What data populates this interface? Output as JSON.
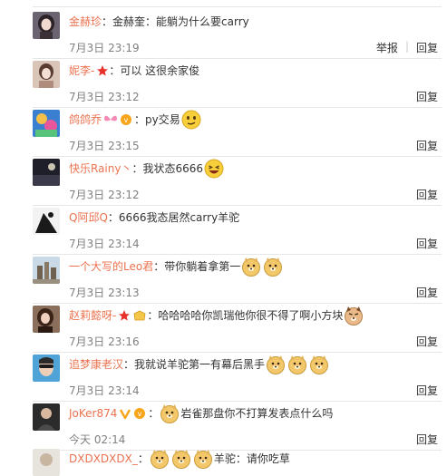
{
  "comments": [
    {
      "username": "金赫珍",
      "text": "金赫奎：能躺为什么要carry",
      "time": "7月3日 23:19",
      "actions": [
        "举报",
        "回复"
      ]
    },
    {
      "username": "妮李-",
      "text": "可以 这很余家俊",
      "time": "7月3日 23:12",
      "actions": [
        "回复"
      ]
    },
    {
      "username": "鸽鸽乔",
      "text": "py交易",
      "time": "7月3日 23:15",
      "actions": [
        "回复"
      ]
    },
    {
      "username": "快乐Rainy丶",
      "text": "我状态6666",
      "time": "7月3日 23:12",
      "actions": [
        "回复"
      ]
    },
    {
      "username": "Q阿邱Q",
      "text": "6666我态居然carry羊驼",
      "time": "7月3日 23:14",
      "actions": [
        "回复"
      ]
    },
    {
      "username": "一个大写的Leo君",
      "text": "带你躺着拿第一",
      "time": "7月3日 23:13",
      "actions": [
        "回复"
      ]
    },
    {
      "username": "赵莉懿呀-",
      "text": "哈哈哈哈你凯瑞他你很不得了啊小方块",
      "time": "7月3日 23:16",
      "actions": [
        "回复"
      ]
    },
    {
      "username": "追梦康老汉",
      "text": "我就说羊驼第一有幕后黑手",
      "time": "7月3日 23:14",
      "actions": [
        "回复"
      ]
    },
    {
      "username": "JoKer874",
      "text": "岩雀那盘你不打算发表点什么吗",
      "time": "今天 02:14",
      "actions": [
        "回复"
      ]
    },
    {
      "username": "DXDXDXDX_",
      "text": "羊驼：请你吃草",
      "time": "",
      "actions": []
    }
  ],
  "colors": {
    "username": "#eb7350",
    "text": "#333333",
    "time": "#808080",
    "divider": "#e6e6e6"
  }
}
